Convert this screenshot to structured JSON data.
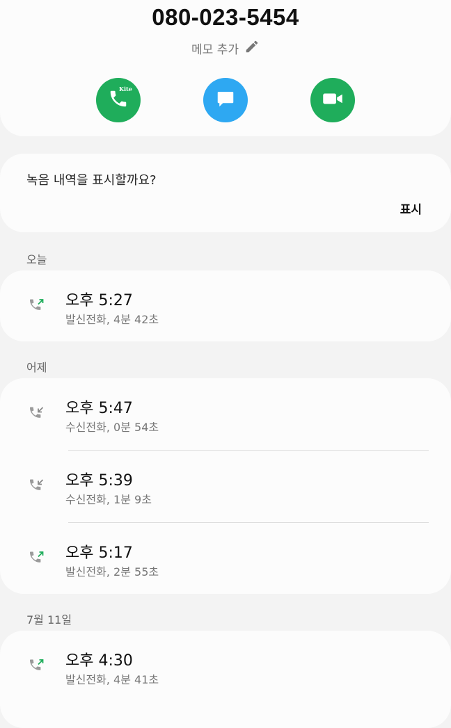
{
  "contact": {
    "phone_number": "080-023-5454",
    "memo_label": "메모 추가"
  },
  "actions": [
    {
      "name": "call",
      "icon": "phone-icon",
      "badge": "Kite",
      "color": "#1fad5b"
    },
    {
      "name": "message",
      "icon": "message-icon",
      "color": "#2ea8f2"
    },
    {
      "name": "video",
      "icon": "video-icon",
      "color": "#1fad5b"
    }
  ],
  "recording_prompt": {
    "question": "녹음 내역을 표시할까요?",
    "button": "표시"
  },
  "call_log": [
    {
      "date_label": "오늘",
      "entries": [
        {
          "time": "오후 5:27",
          "detail": "발신전화, 4분 42초",
          "direction": "outgoing"
        }
      ]
    },
    {
      "date_label": "어제",
      "entries": [
        {
          "time": "오후 5:47",
          "detail": "수신전화, 0분 54초",
          "direction": "incoming"
        },
        {
          "time": "오후 5:39",
          "detail": "수신전화, 1분 9초",
          "direction": "incoming"
        },
        {
          "time": "오후 5:17",
          "detail": "발신전화, 2분 55초",
          "direction": "outgoing"
        }
      ]
    },
    {
      "date_label": "7월 11일",
      "entries": [
        {
          "time": "오후 4:30",
          "detail": "발신전화, 4분 41초",
          "direction": "outgoing"
        }
      ]
    }
  ],
  "colors": {
    "outgoing_arrow": "#1fad5b",
    "incoming_arrow": "#888888",
    "background": "#f3f3f3",
    "card": "#fcfcfc"
  }
}
